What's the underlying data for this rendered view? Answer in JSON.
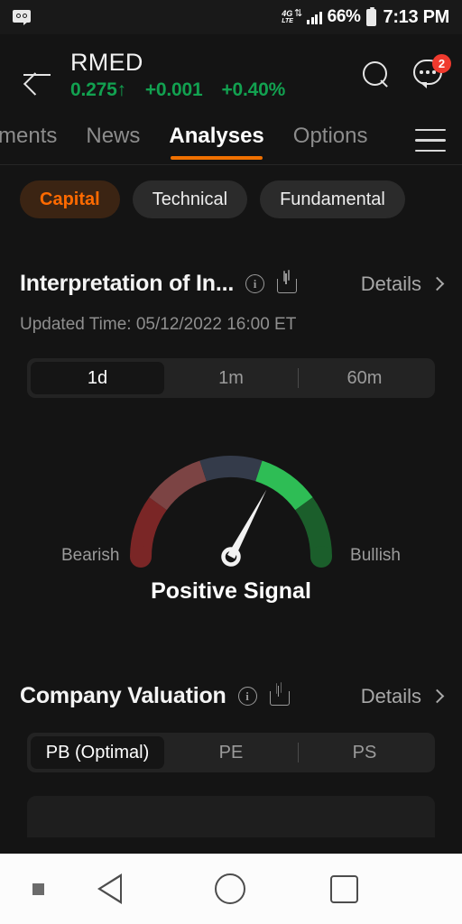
{
  "status_bar": {
    "notification_icon": "voicemail-icon",
    "network_label": "4G",
    "network_sub": "LTE",
    "battery_percent": "66%",
    "time": "7:13 PM"
  },
  "app_bar": {
    "back_icon": "back-arrow-icon",
    "ticker": "RMED",
    "price": "0.275",
    "price_arrow": "↑",
    "change": "+0.001",
    "change_percent": "+0.40%",
    "up_color": "#12a150",
    "search_icon": "search-icon",
    "chat_icon": "chat-bubble-icon",
    "chat_badge": "2"
  },
  "tabs": {
    "items": [
      {
        "label": "ments",
        "active": false,
        "clipped": true
      },
      {
        "label": "News",
        "active": false
      },
      {
        "label": "Analyses",
        "active": true
      },
      {
        "label": "Options",
        "active": false
      }
    ],
    "menu_icon": "hamburger-menu-icon",
    "active_underline_color": "#f07000"
  },
  "chips": {
    "items": [
      {
        "label": "Capital",
        "active": true
      },
      {
        "label": "Technical",
        "active": false
      },
      {
        "label": "Fundamental",
        "active": false
      }
    ],
    "active_text_color": "#ff6a00",
    "active_bg_color": "#3b2413"
  },
  "interpretation": {
    "title": "Interpretation of In...",
    "info_icon": "info-icon",
    "share_icon": "share-icon",
    "details_label": "Details",
    "chevron_icon": "chevron-right-icon",
    "updated": "Updated Time: 05/12/2022 16:00 ET",
    "segments": [
      {
        "label": "1d",
        "active": true
      },
      {
        "label": "1m",
        "active": false
      },
      {
        "label": "60m",
        "active": false
      }
    ],
    "left_label": "Bearish",
    "right_label": "Bullish",
    "signal_text": "Positive Signal"
  },
  "chart_data": {
    "type": "gauge",
    "title": "Interpretation of Indicators",
    "value_label": "Positive Signal",
    "min_label": "Bearish",
    "max_label": "Bullish",
    "needle_angle_deg": 118,
    "needle_value": 0.655,
    "range": [
      0,
      1
    ],
    "segments": [
      {
        "name": "Very Bearish",
        "from": 0.0,
        "to": 0.2,
        "color": "#7a2626"
      },
      {
        "name": "Bearish",
        "from": 0.2,
        "to": 0.4,
        "color": "#7c4444"
      },
      {
        "name": "Neutral",
        "from": 0.4,
        "to": 0.6,
        "color": "#343b4a"
      },
      {
        "name": "Bullish",
        "from": 0.6,
        "to": 0.8,
        "color": "#2ebd55"
      },
      {
        "name": "Very Bullish",
        "from": 0.8,
        "to": 1.0,
        "color": "#1b5e2b"
      }
    ],
    "needle_color": "#f2f2f2"
  },
  "valuation": {
    "title": "Company Valuation",
    "info_icon": "info-icon",
    "share_icon": "share-icon",
    "details_label": "Details",
    "chevron_icon": "chevron-right-icon",
    "segments": [
      {
        "label": "PB (Optimal)",
        "active": true
      },
      {
        "label": "PE",
        "active": false
      },
      {
        "label": "PS",
        "active": false
      }
    ]
  },
  "nav_bar": {
    "dot_icon": "square-dot-icon",
    "back_icon": "nav-back-triangle-icon",
    "home_icon": "nav-home-circle-icon",
    "recents_icon": "nav-recents-square-icon"
  }
}
